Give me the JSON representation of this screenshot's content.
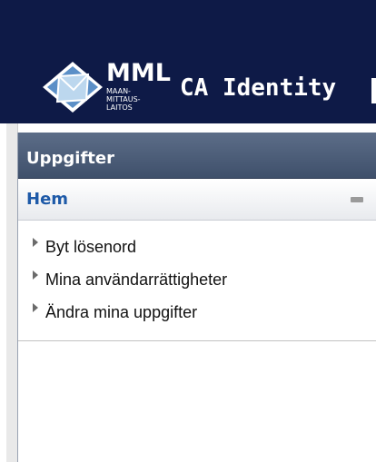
{
  "header": {
    "logo": {
      "brand": "MML",
      "sub_lines": [
        "MAAN-",
        "MITTAUS-",
        "LAITOS"
      ]
    },
    "app_title": "CA Identity"
  },
  "panel": {
    "title": "Uppgifter",
    "section": {
      "title": "Hem",
      "collapse_icon": "minus-icon",
      "items": [
        {
          "label": "Byt lösenord",
          "icon": "triangle-right-icon"
        },
        {
          "label": "Mina användarrättigheter",
          "icon": "triangle-right-icon"
        },
        {
          "label": "Ändra mina uppgifter",
          "icon": "triangle-right-icon"
        }
      ]
    }
  },
  "colors": {
    "header_bg": "#0e1a47",
    "panel_header_bg": "#4a5a75",
    "section_title": "#1e5aa8"
  }
}
